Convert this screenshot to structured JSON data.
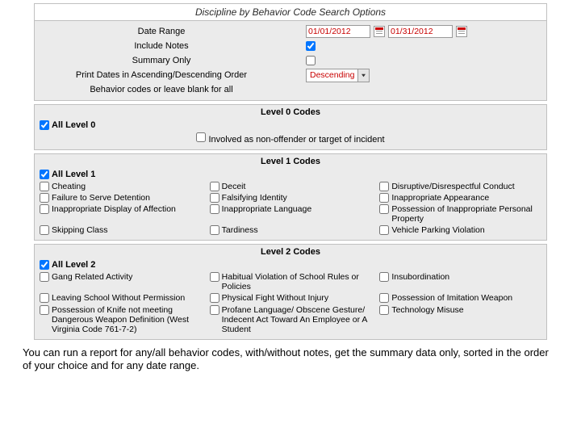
{
  "title": "Discipline by Behavior Code Search Options",
  "form": {
    "date_range_label": "Date Range",
    "date_from": "01/01/2012",
    "date_to": "01/31/2012",
    "include_notes_label": "Include Notes",
    "include_notes_checked": true,
    "summary_only_label": "Summary Only",
    "summary_only_checked": false,
    "order_label": "Print Dates in Ascending/Descending Order",
    "order_value": "Descending",
    "behavior_label": "Behavior codes or leave blank for all"
  },
  "level0": {
    "heading": "Level 0 Codes",
    "all_label": "All Level 0",
    "items": [
      "Involved as non-offender or target of incident"
    ]
  },
  "level1": {
    "heading": "Level 1 Codes",
    "all_label": "All Level 1",
    "items": [
      "Cheating",
      "Deceit",
      "Disruptive/Disrespectful Conduct",
      "Failure to Serve Detention",
      "Falsifying Identity",
      "Inappropriate Appearance",
      "Inappropriate Display of Affection",
      "Inappropriate Language",
      "Possession of Inappropriate Personal Property",
      "Skipping Class",
      "Tardiness",
      "Vehicle Parking Violation"
    ]
  },
  "level2": {
    "heading": "Level 2 Codes",
    "all_label": "All Level 2",
    "items": [
      "Gang Related Activity",
      "Habitual Violation of School Rules or Policies",
      "Insubordination",
      "Leaving School Without Permission",
      "Physical Fight Without Injury",
      "Possession of Imitation Weapon",
      "Possession of Knife not meeting Dangerous Weapon Definition (West Virginia Code 761-7-2)",
      "Profane Language/ Obscene Gesture/ Indecent Act Toward An Employee or A Student",
      "Technology Misuse"
    ]
  },
  "footer": "You can run a report for any/all behavior codes, with/without notes, get the summary data only, sorted in the order of your choice and for any date range."
}
